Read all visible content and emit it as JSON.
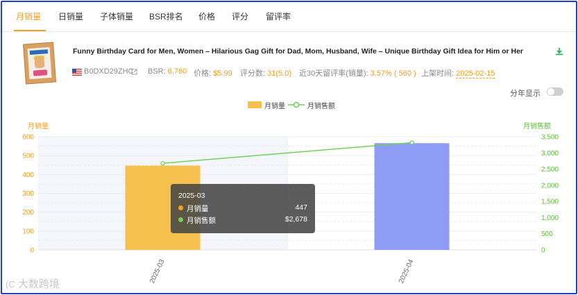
{
  "tabs": [
    {
      "label": "月销量",
      "active": true
    },
    {
      "label": "日销量"
    },
    {
      "label": "子体销量"
    },
    {
      "label": "BSR排名"
    },
    {
      "label": "价格"
    },
    {
      "label": "评分"
    },
    {
      "label": "留评率"
    }
  ],
  "product": {
    "title": "Funny Birthday Card for Men, Women – Hilarious Gag Gift for Dad, Mom, Husband, Wife – Unique Birthday Gift Idea for Him or Her",
    "asin": "B0DXD29ZHC",
    "bsr_label": "BSR: ",
    "bsr_value": "6,760",
    "price_label": "价格: ",
    "price_value": "$5.99",
    "rating_label": "评分数: ",
    "rating_value": "31(5.0)",
    "review_rate_label": "近30天留评率(销量): ",
    "review_rate_value": "3.57% ( 560 )",
    "listed_label": "上架时间: ",
    "listed_value": "2025-02-15"
  },
  "toggle": {
    "label": "分年显示",
    "on": false
  },
  "legend": {
    "bar_label": "月销量",
    "line_label": "月销售额"
  },
  "colors": {
    "accent": "#f0a020",
    "bar1": "#f5c04e",
    "bar2": "#8e9cf5",
    "line": "#6fd15a",
    "right_axis": "#5cbf3a"
  },
  "chart_data": {
    "type": "bar",
    "categories": [
      "2025-03",
      "2025-04"
    ],
    "series": [
      {
        "name": "月销量",
        "type": "bar",
        "axis": "left",
        "values": [
          447,
          566
        ]
      },
      {
        "name": "月销售额",
        "type": "line",
        "axis": "right",
        "values": [
          2678,
          3318
        ]
      }
    ],
    "left_axis": {
      "label": "月销量",
      "ylim": [
        0,
        600
      ],
      "ticks": [
        0,
        100,
        200,
        300,
        400,
        500,
        600
      ]
    },
    "right_axis": {
      "label": "月销售额",
      "ylim": [
        0,
        3500
      ],
      "ticks": [
        "0",
        "500",
        "1,000",
        "1,500",
        "2,000",
        "2,500",
        "3,000",
        "3,500"
      ]
    }
  },
  "tooltip": {
    "title": "2025-03",
    "rows": [
      {
        "label": "月销量",
        "value": "447"
      },
      {
        "label": "月销售额",
        "value": "$2,678"
      }
    ]
  },
  "watermark": "大数跨境",
  "icons": {
    "download": "download-icon",
    "flag": "us-flag-icon",
    "external": "external-link-icon"
  }
}
